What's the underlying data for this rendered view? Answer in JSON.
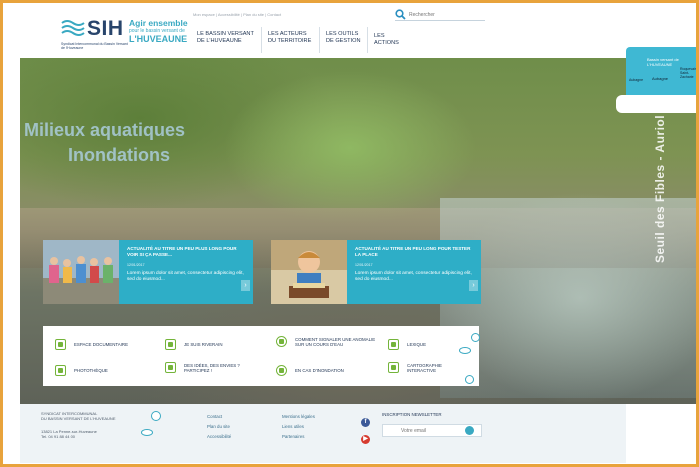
{
  "header": {
    "logo": {
      "name": "SIH",
      "subtitle": "Syndicat Intercommunal du Bassin Versant de l'Huveaune",
      "tagline1": "Agir ensemble",
      "tagline2": "pour le bassin versant de",
      "tagline3": "L'HUVEAUNE"
    },
    "top_links": "Mon espace | Accessibilité | Plan du site | Contact",
    "search_placeholder": "Rechercher",
    "nav": [
      {
        "label": "LE BASSIN VERSANT DE L'HUVEAUNE"
      },
      {
        "label": "LES ACTEURS DU TERRITOIRE"
      },
      {
        "label": "LES OUTILS DE GESTION"
      },
      {
        "label": "LES ACTIONS"
      }
    ]
  },
  "hero": {
    "title_line1": "Milieux aquatiques",
    "title_line2": "Inondations",
    "caption": "Seuil des Fibles - Auriol"
  },
  "map_badge": {
    "title": "Bassin versant de L'HUVEAUNE",
    "label_left": "Aubagne",
    "label_right": "Roquevaire Saint-Zacharie",
    "label_mid": "Aubagne"
  },
  "news": [
    {
      "title": "ACTUALITÉ AU TITRE UN PEU PLUS LONG POUR VOIR SI ÇA PASSE...",
      "date": "12/01/2017",
      "body": "Lorem ipsum dolor sit amet, consectetur adipiscing elit, sed do eiusmod...",
      "arrow": "›"
    },
    {
      "title": "ACTUALITÉ AU TITRE UN PEU LONG POUR TESTER LA PLACE",
      "date": "12/01/2017",
      "body": "Lorem ipsum dolor sit amet, consectetur adipiscing elit, sed do eiusmod...",
      "arrow": "›"
    }
  ],
  "quick_links": [
    {
      "label": "ESPACE DOCUMENTAIRE"
    },
    {
      "label": "JE SUIS RIVERAIN"
    },
    {
      "label": "COMMENT SIGNALER UNE ANOMALIE SUR UN COURS D'EAU"
    },
    {
      "label": "LEXIQUE"
    },
    {
      "label": "PHOTOTHÈQUE"
    },
    {
      "label": "DES IDÉES, DES ENVIES ? PARTICIPEZ !"
    },
    {
      "label": "EN CAS D'INONDATION"
    },
    {
      "label": "CARTOGRAPHIE INTERACTIVE"
    }
  ],
  "footer": {
    "org_line1": "SYNDICAT INTERCOMMUNAL",
    "org_line2": "DU BASSIN VERSANT DE L'HUVEAUNE",
    "addr_line1": "13821 La Penne-sur-Huveaune",
    "addr_line2": "Tel. 04 91 88 44 00",
    "col1": [
      "Contact",
      "Plan du site",
      "Accessibilité"
    ],
    "col2": [
      "Mentions légales",
      "Liens utiles",
      "Partenaires"
    ],
    "facebook": "f",
    "youtube": "▶",
    "newsletter_title": "INSCRIPTION NEWSLETTER",
    "newsletter_placeholder": "Votre email"
  },
  "colors": {
    "accent": "#2eaec7",
    "navy": "#1f3352",
    "green": "#74b43a",
    "frame": "#e8a33c"
  }
}
